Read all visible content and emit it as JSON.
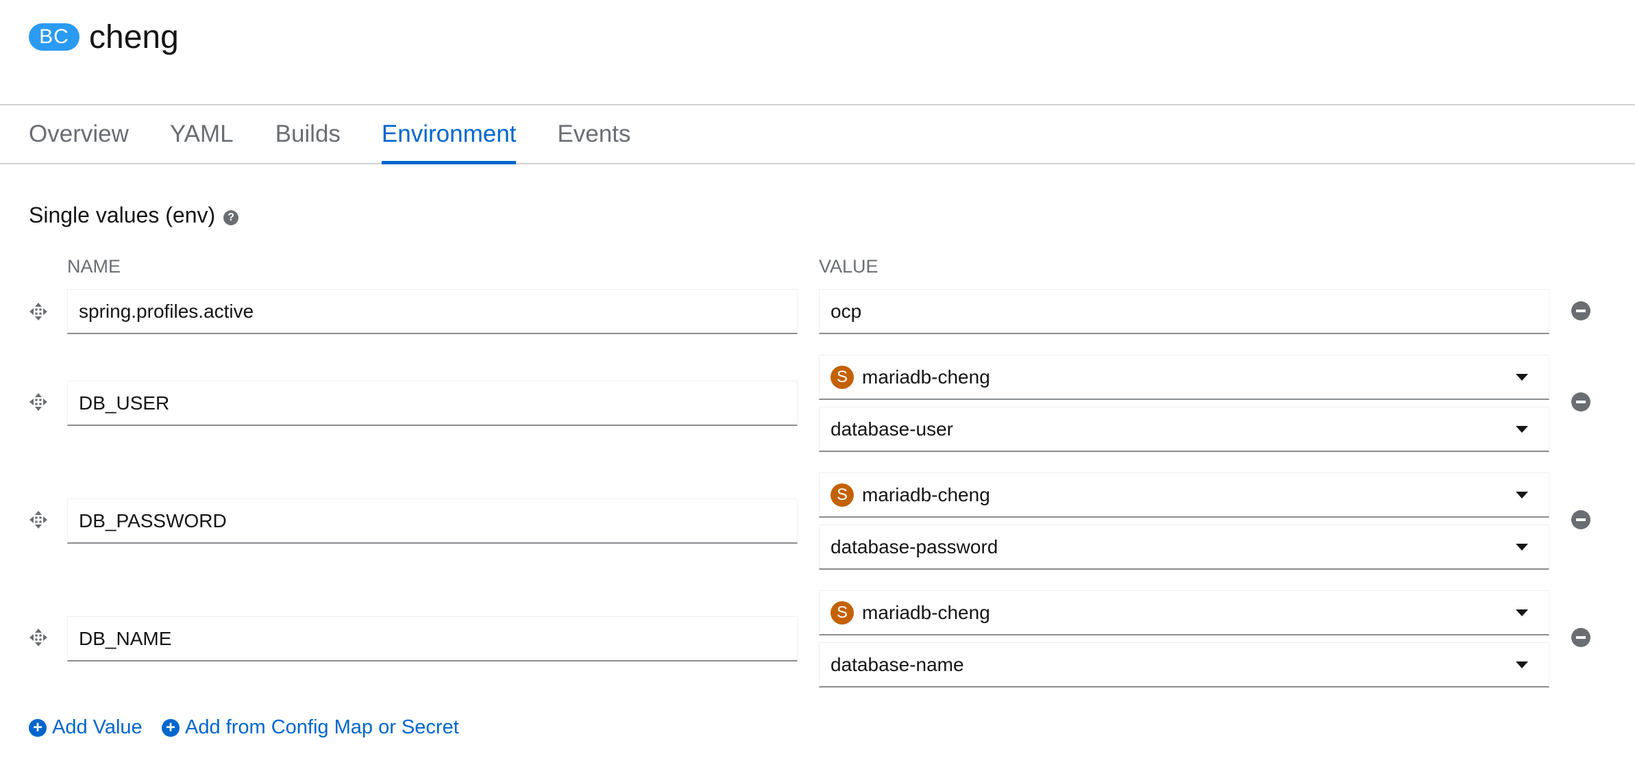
{
  "header": {
    "badge": "BC",
    "title": "cheng"
  },
  "tabs": [
    {
      "label": "Overview",
      "active": false
    },
    {
      "label": "YAML",
      "active": false
    },
    {
      "label": "Builds",
      "active": false
    },
    {
      "label": "Environment",
      "active": true
    },
    {
      "label": "Events",
      "active": false
    }
  ],
  "section": {
    "title": "Single values (env)",
    "name_header": "NAME",
    "value_header": "VALUE"
  },
  "env": [
    {
      "name": "spring.profiles.active",
      "value": "ocp"
    },
    {
      "name": "DB_USER",
      "resource_badge": "S",
      "resource": "mariadb-cheng",
      "key": "database-user"
    },
    {
      "name": "DB_PASSWORD",
      "resource_badge": "S",
      "resource": "mariadb-cheng",
      "key": "database-password"
    },
    {
      "name": "DB_NAME",
      "resource_badge": "S",
      "resource": "mariadb-cheng",
      "key": "database-name"
    }
  ],
  "actions": {
    "add_value": "Add Value",
    "add_from_config": "Add from Config Map or Secret"
  },
  "colors": {
    "accent": "#0066cc",
    "badge_bc": "#2b9af3",
    "badge_secret": "#c46100",
    "muted": "#6a6e73"
  }
}
